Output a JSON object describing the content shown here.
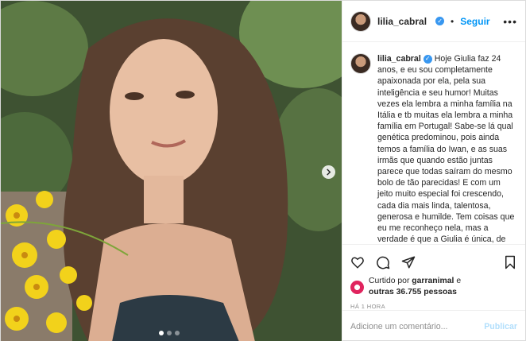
{
  "post": {
    "header": {
      "username": "lilia_cabral",
      "separator": "•",
      "follow_label": "Seguir",
      "more_label": "•••"
    },
    "caption": {
      "username": "lilia_cabral",
      "text": "Hoje Giulia faz 24 anos, e eu sou completamente apaixonada por ela, pela sua inteligência e seu humor! Muitas vezes ela lembra a minha família na Itália e tb muitas ela lembra a minha família em Portugal! Sabe-se lá qual genética predominou, pois ainda temos a família do Iwan, e as suas irmãs que quando estão juntas parece que todas saíram do mesmo bolo de tão parecidas! E com um jeito muito especial foi crescendo, cada dia mais linda, talentosa, generosa e humilde. Tem coisas que eu me reconheço nela, mas a verdade é que a Giulia é única, de personalidade forte, e mostrou e mostra todos os dias como enfrentar essa pandemia! Parabéns, que Deus te ilumine, te"
    },
    "likes": {
      "prefix": "Curtido por ",
      "first_user": "garranimal",
      "middle": " e ",
      "others": "outras 36.755 pessoas"
    },
    "time_ago": "HÁ 1 HORA",
    "comment": {
      "placeholder": "Adicione um comentário...",
      "publish_label": "Publicar"
    },
    "carousel": {
      "total": 3,
      "active_index": 0
    },
    "colors": {
      "accent": "#0095f6",
      "verified": "#3897f0",
      "publish_disabled": "#b2dffc",
      "like_avatar": "#e0245e"
    },
    "icons": {
      "like": "heart-icon",
      "comment": "comment-icon",
      "share": "share-icon",
      "save": "bookmark-icon",
      "next": "chevron-right-icon",
      "verified": "verified-badge-icon"
    }
  }
}
